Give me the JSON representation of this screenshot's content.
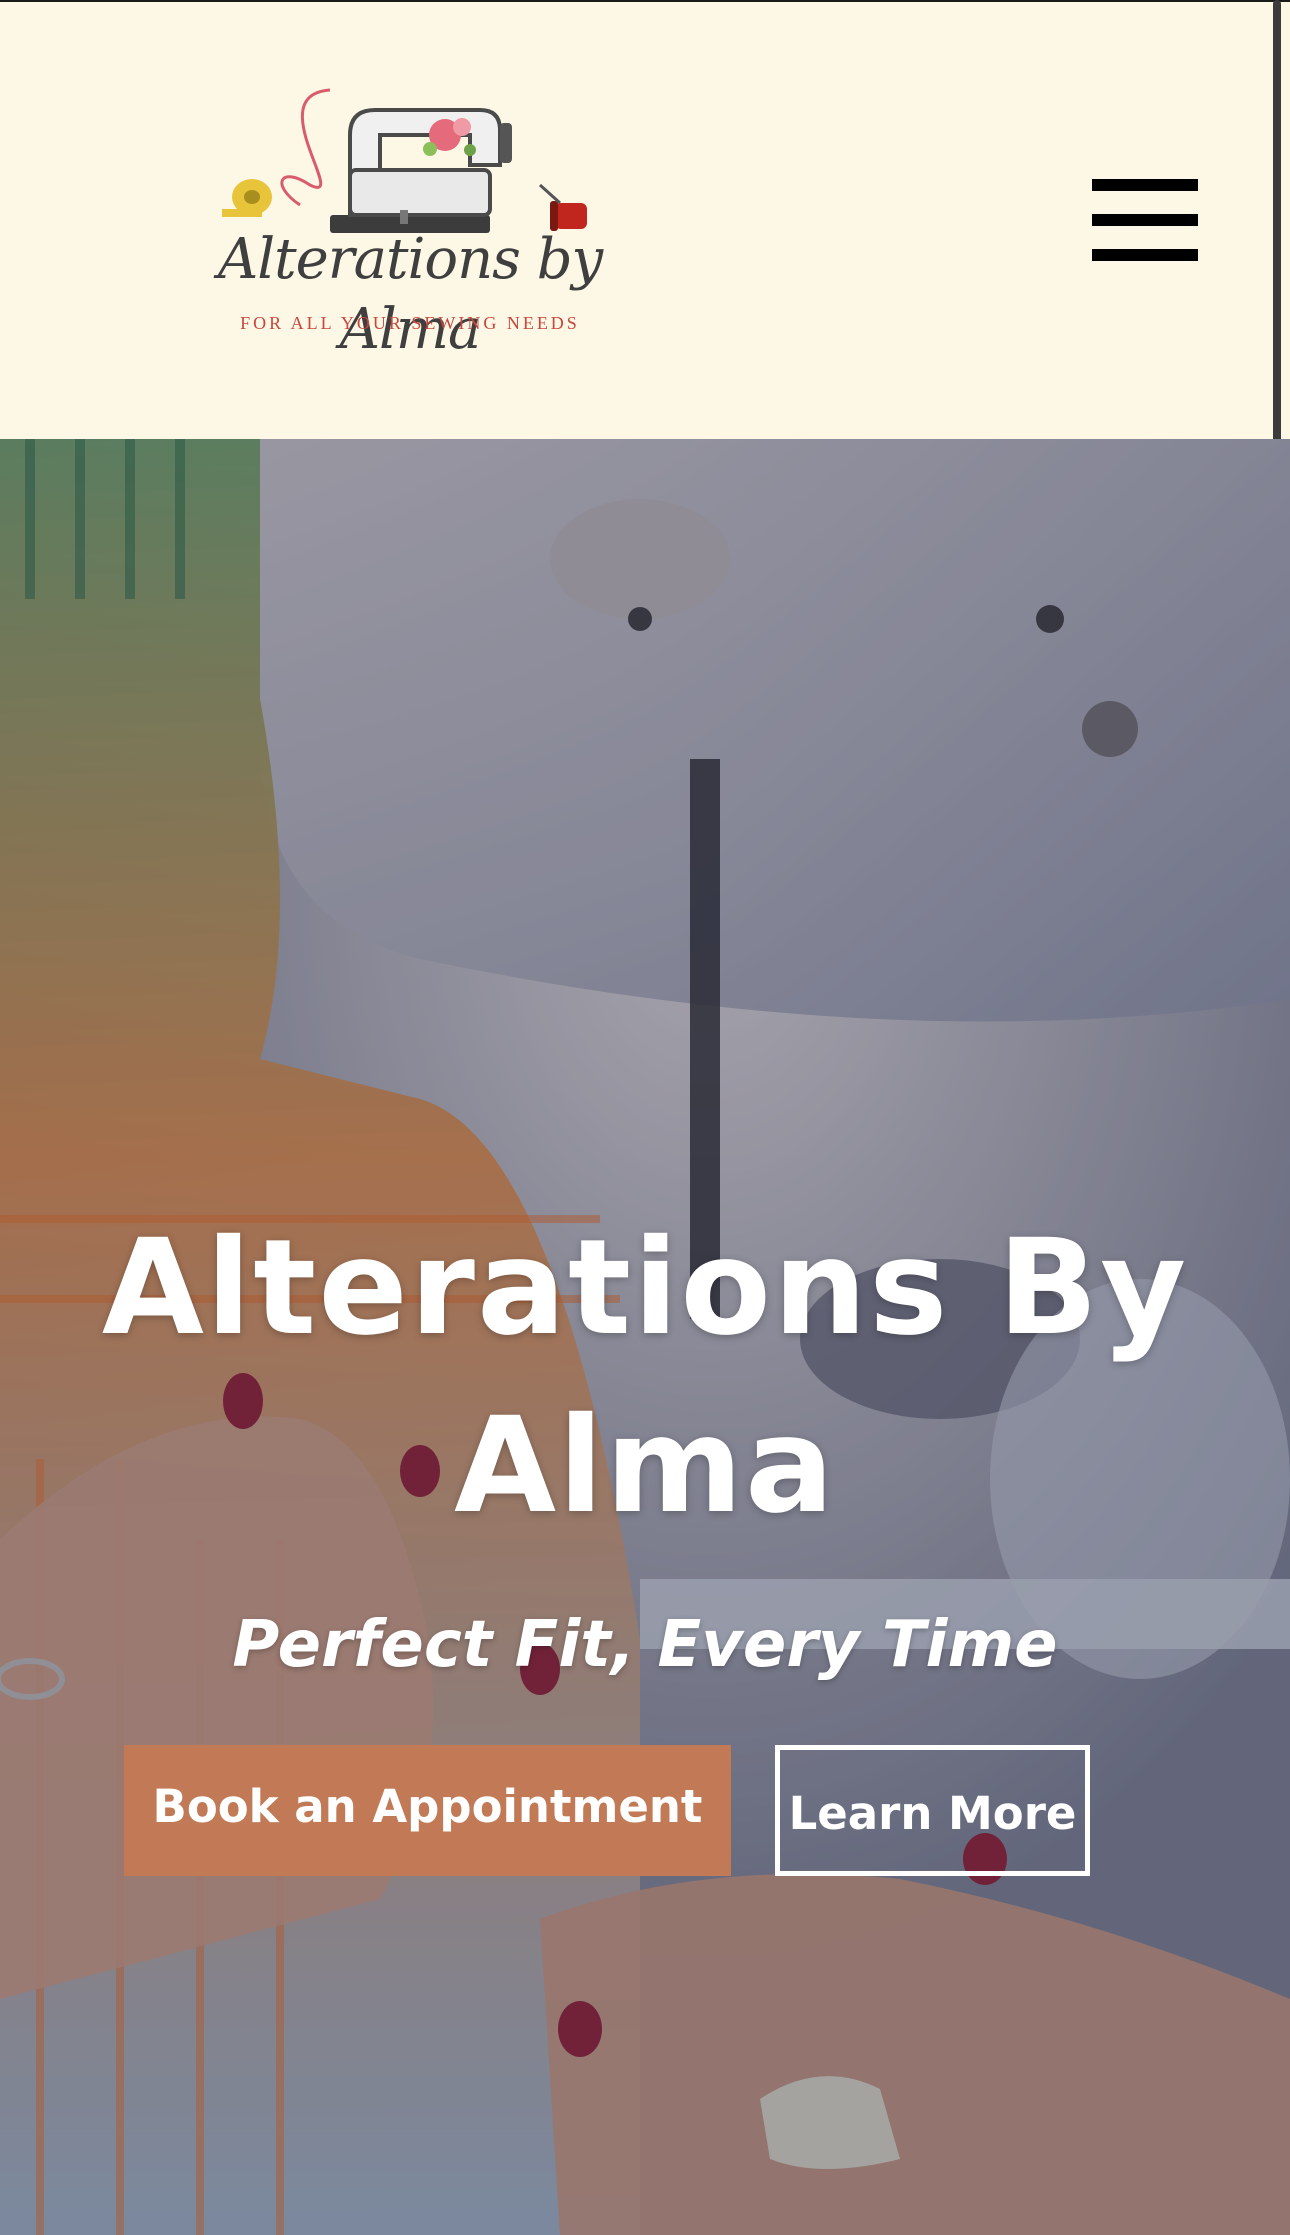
{
  "header": {
    "logo": {
      "script_text": "Alterations by Alma",
      "tagline": "FOR ALL YOUR SEWING NEEDS"
    },
    "menu_icon": "hamburger-menu-icon"
  },
  "hero": {
    "title": "Alterations By Alma",
    "subtitle": "Perfect Fit, Every Time",
    "primary_button": "Book an Appointment",
    "secondary_button": "Learn More"
  },
  "colors": {
    "header_bg": "#fdf7e6",
    "primary_button_bg": "#c17a55",
    "text_on_hero": "#ffffff",
    "tagline": "#c7473d"
  }
}
